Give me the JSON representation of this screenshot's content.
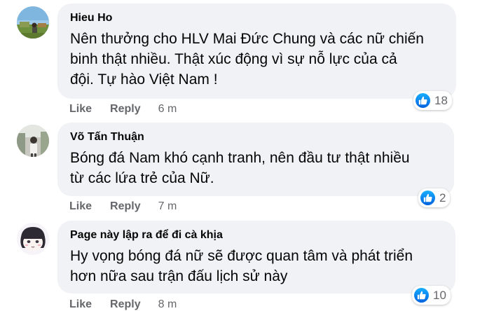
{
  "colors": {
    "bubble_background": "#f0f2f5",
    "like_blue": "#1877f2",
    "secondary_text": "#65676b",
    "primary_text": "#050505"
  },
  "comments": [
    {
      "author": "Hieu Ho",
      "text": "Nên thưởng cho HLV Mai Đức Chung và các nữ chiến\nbinh thật nhiều. Thật xúc động vì sự nỗ lực của cả\nđội. Tự hào Việt Nam !",
      "reaction_icon": "like-icon",
      "reaction_count": "18",
      "like_label": "Like",
      "reply_label": "Reply",
      "timestamp": "6 m",
      "avatar_icon": "avatar-landscape"
    },
    {
      "author": "Võ Tấn Thuận",
      "text": "Bóng đá Nam khó cạnh tranh, nên đầu tư thật nhiều\ntừ các lứa trẻ của Nữ.",
      "reaction_icon": "like-icon",
      "reaction_count": "2",
      "like_label": "Like",
      "reply_label": "Reply",
      "timestamp": "7 m",
      "avatar_icon": "avatar-person-outdoors"
    },
    {
      "author": "Page này lập ra để đi cà khịa",
      "text": "Hy vọng bóng đá nữ sẽ được quan tâm và phát triển\nhơn nữa sau trận đấu lịch sử này",
      "reaction_icon": "like-icon",
      "reaction_count": "10",
      "like_label": "Like",
      "reply_label": "Reply",
      "timestamp": "8 m",
      "avatar_icon": "avatar-cartoon-face"
    }
  ]
}
